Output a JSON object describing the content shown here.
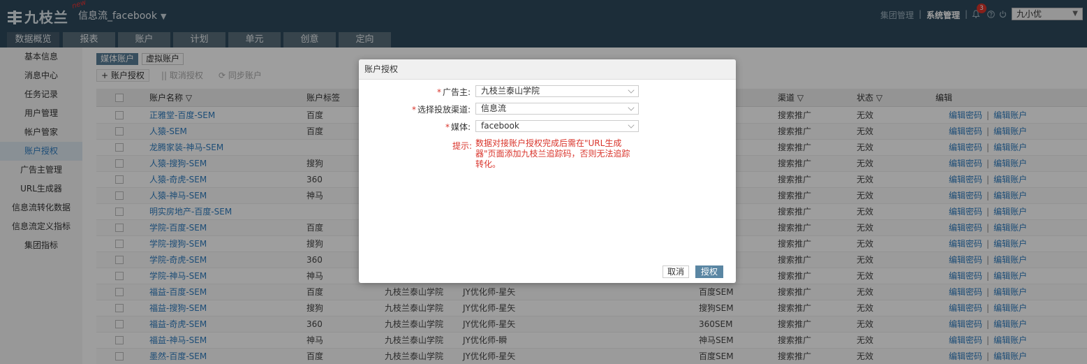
{
  "header": {
    "logo": "九枝兰",
    "new_tag": "new",
    "app_name": "信息流_facebook",
    "group_mgmt": "集团管理",
    "system_mgmt": "系统管理",
    "separator": "|",
    "notification_count": "3",
    "user": "九小优"
  },
  "nav": {
    "tabs": [
      "数据概览",
      "报表",
      "账户",
      "计划",
      "单元",
      "创意",
      "定向"
    ]
  },
  "sidebar": {
    "items": [
      "基本信息",
      "消息中心",
      "任务记录",
      "用户管理",
      "帐户管家",
      "账户授权",
      "广告主管理",
      "URL生成器",
      "信息流转化数据",
      "信息流定义指标",
      "集团指标"
    ],
    "active": "账户授权"
  },
  "subtabs": [
    "媒体账户",
    "虚拟账户"
  ],
  "toolbar": {
    "authorize": "+ 账户授权",
    "cancel_auth": "|| 取消授权",
    "sync": "同步账户"
  },
  "table": {
    "headers": {
      "name": "账户名称",
      "tag": "账户标签",
      "channel": "渠道",
      "status": "状态",
      "edit": "编辑"
    },
    "ops": {
      "edit_pwd": "编辑密码",
      "edit_acct": "编辑账户",
      "bar": "|"
    },
    "rows": [
      {
        "name": "正雅堂-百度-SEM",
        "tag": "百度",
        "advertiser": "",
        "owner": "",
        "media": "",
        "channel": "搜索推广",
        "status": "无效"
      },
      {
        "name": "人猿-SEM",
        "tag": "百度",
        "advertiser": "",
        "owner": "",
        "media": "",
        "channel": "搜索推广",
        "status": "无效"
      },
      {
        "name": "龙腾家装-神马-SEM",
        "tag": "",
        "advertiser": "",
        "owner": "",
        "media": "",
        "channel": "搜索推广",
        "status": "无效"
      },
      {
        "name": "人猿-搜狗-SEM",
        "tag": "搜狗",
        "advertiser": "",
        "owner": "",
        "media": "",
        "channel": "搜索推广",
        "status": "无效"
      },
      {
        "name": "人猿-奇虎-SEM",
        "tag": "360",
        "advertiser": "",
        "owner": "",
        "media": "",
        "channel": "搜索推广",
        "status": "无效"
      },
      {
        "name": "人猿-神马-SEM",
        "tag": "神马",
        "advertiser": "",
        "owner": "",
        "media": "",
        "channel": "搜索推广",
        "status": "无效"
      },
      {
        "name": "明实房地产-百度-SEM",
        "tag": "",
        "advertiser": "",
        "owner": "",
        "media": "",
        "channel": "搜索推广",
        "status": "无效"
      },
      {
        "name": "学院-百度-SEM",
        "tag": "百度",
        "advertiser": "",
        "owner": "",
        "media": "",
        "channel": "搜索推广",
        "status": "无效"
      },
      {
        "name": "学院-搜狗-SEM",
        "tag": "搜狗",
        "advertiser": "",
        "owner": "",
        "media": "",
        "channel": "搜索推广",
        "status": "无效"
      },
      {
        "name": "学院-奇虎-SEM",
        "tag": "360",
        "advertiser": "",
        "owner": "",
        "media": "",
        "channel": "搜索推广",
        "status": "无效"
      },
      {
        "name": "学院-神马-SEM",
        "tag": "神马",
        "advertiser": "",
        "owner": "",
        "media": "",
        "channel": "搜索推广",
        "status": "无效"
      },
      {
        "name": "福益-百度-SEM",
        "tag": "百度",
        "advertiser": "九枝兰泰山学院",
        "owner": "JY优化师-星矢",
        "media": "百度SEM",
        "channel": "搜索推广",
        "status": "无效"
      },
      {
        "name": "福益-搜狗-SEM",
        "tag": "搜狗",
        "advertiser": "九枝兰泰山学院",
        "owner": "JY优化师-星矢",
        "media": "搜狗SEM",
        "channel": "搜索推广",
        "status": "无效"
      },
      {
        "name": "福益-奇虎-SEM",
        "tag": "360",
        "advertiser": "九枝兰泰山学院",
        "owner": "JY优化师-星矢",
        "media": "360SEM",
        "channel": "搜索推广",
        "status": "无效"
      },
      {
        "name": "福益-神马-SEM",
        "tag": "神马",
        "advertiser": "九枝兰泰山学院",
        "owner": "JY优化师-瞬",
        "media": "神马SEM",
        "channel": "搜索推广",
        "status": "无效"
      },
      {
        "name": "墨然-百度-SEM",
        "tag": "百度",
        "advertiser": "九枝兰泰山学院",
        "owner": "JY优化师-星矢",
        "media": "百度SEM",
        "channel": "搜索推广",
        "status": "无效"
      }
    ]
  },
  "modal": {
    "title": "账户授权",
    "advertiser_label": "广告主:",
    "advertiser_value": "九枝兰泰山学院",
    "channel_label": "选择投放渠道:",
    "channel_value": "信息流",
    "media_label": "媒体:",
    "media_value": "facebook",
    "required_mark": "*",
    "tip_label": "提示:",
    "tip_text": "数据对接账户授权完成后需在\"URL生成器\"页面添加九枝兰追踪码，否则无法追踪转化。",
    "cancel": "取消",
    "confirm": "授权"
  }
}
